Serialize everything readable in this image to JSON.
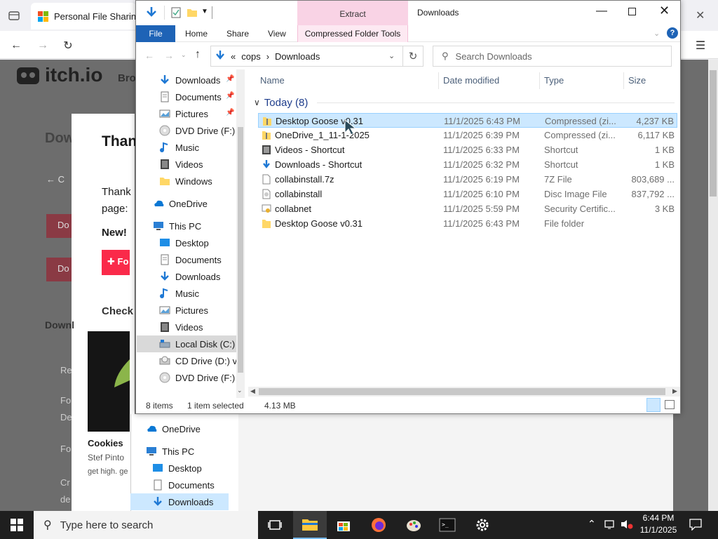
{
  "browser": {
    "tab_title": "Personal File Sharing &",
    "close_tab": "✕"
  },
  "page": {
    "logo": "itch.io",
    "bro": "Bro",
    "dow": "Dow",
    "than": "Than",
    "thank": "Thank",
    "page_lbl": "page:",
    "new_lbl": "New!",
    "back": "← C",
    "do1": "Do",
    "do2": "Do",
    "check": "Check",
    "downl": "Downl",
    "re": "Re",
    "fo": "Fo",
    "de": "De",
    "fo2": "Fo",
    "cr": "Cr",
    "de2": "de",
    "cookies": "Cookies",
    "stef": "Stef Pinto",
    "gethigh": "get high. ge",
    "plus_btn": "Fo"
  },
  "explorer": {
    "title": "Downloads",
    "extract": "Extract",
    "ribbon": {
      "file": "File",
      "home": "Home",
      "share": "Share",
      "view": "View",
      "tools": "Compressed Folder Tools"
    },
    "address": {
      "prefix": "«",
      "crumb1": "cops",
      "sep": "›",
      "crumb2": "Downloads"
    },
    "search_placeholder": "Search Downloads",
    "nav": [
      {
        "label": "Downloads",
        "pin": true
      },
      {
        "label": "Documents",
        "pin": true
      },
      {
        "label": "Pictures",
        "pin": true
      },
      {
        "label": "DVD Drive (F:) ",
        "pin": false
      },
      {
        "label": "Music",
        "pin": false
      },
      {
        "label": "Videos",
        "pin": false
      },
      {
        "label": "Windows",
        "pin": false
      },
      {
        "label": "OneDrive",
        "pin": false
      },
      {
        "label": "This PC",
        "pin": false
      },
      {
        "label": "Desktop",
        "pin": false
      },
      {
        "label": "Documents",
        "pin": false
      },
      {
        "label": "Downloads",
        "pin": false
      },
      {
        "label": "Music",
        "pin": false
      },
      {
        "label": "Pictures",
        "pin": false
      },
      {
        "label": "Videos",
        "pin": false
      },
      {
        "label": "Local Disk (C:)",
        "pin": false
      },
      {
        "label": "CD Drive (D:) vi",
        "pin": false
      },
      {
        "label": "DVD Drive (F:) ",
        "pin": false
      }
    ],
    "columns": {
      "name": "Name",
      "date": "Date modified",
      "type": "Type",
      "size": "Size"
    },
    "group": "Today (8)",
    "files": [
      {
        "name": "Desktop Goose v0.31",
        "date": "11/1/2025 6:43 PM",
        "type": "Compressed (zi...",
        "size": "4,237 KB",
        "icon": "zip-icon"
      },
      {
        "name": "OneDrive_1_11-1-2025",
        "date": "11/1/2025 6:39 PM",
        "type": "Compressed (zi...",
        "size": "6,117 KB",
        "icon": "zip-icon"
      },
      {
        "name": "Videos - Shortcut",
        "date": "11/1/2025 6:33 PM",
        "type": "Shortcut",
        "size": "1 KB",
        "icon": "shortcut-icon"
      },
      {
        "name": "Downloads - Shortcut",
        "date": "11/1/2025 6:32 PM",
        "type": "Shortcut",
        "size": "1 KB",
        "icon": "shortcut-icon"
      },
      {
        "name": "collabinstall.7z",
        "date": "11/1/2025 6:19 PM",
        "type": "7Z File",
        "size": "803,689 ...",
        "icon": "file-icon"
      },
      {
        "name": "collabinstall",
        "date": "11/1/2025 6:10 PM",
        "type": "Disc Image File",
        "size": "837,792 ...",
        "icon": "disc-image-icon"
      },
      {
        "name": "collabnet",
        "date": "11/1/2025 5:59 PM",
        "type": "Security Certific...",
        "size": "3 KB",
        "icon": "certificate-icon"
      },
      {
        "name": "Desktop Goose v0.31",
        "date": "11/1/2025 6:43 PM",
        "type": "File folder",
        "size": "",
        "icon": "folder-icon"
      }
    ],
    "status": {
      "count": "8 items",
      "selected": "1 item selected",
      "size": "4.13 MB"
    }
  },
  "back_explorer": {
    "items": [
      "OneDrive",
      "This PC",
      "Desktop",
      "Documents",
      "Downloads"
    ]
  },
  "taskbar": {
    "search": "Type here to search",
    "time": "6:44 PM",
    "date": "11/1/2025"
  },
  "colors": {
    "accent": "#1e63b6",
    "extract": "#f9d3e5",
    "selection": "#cce8ff"
  }
}
